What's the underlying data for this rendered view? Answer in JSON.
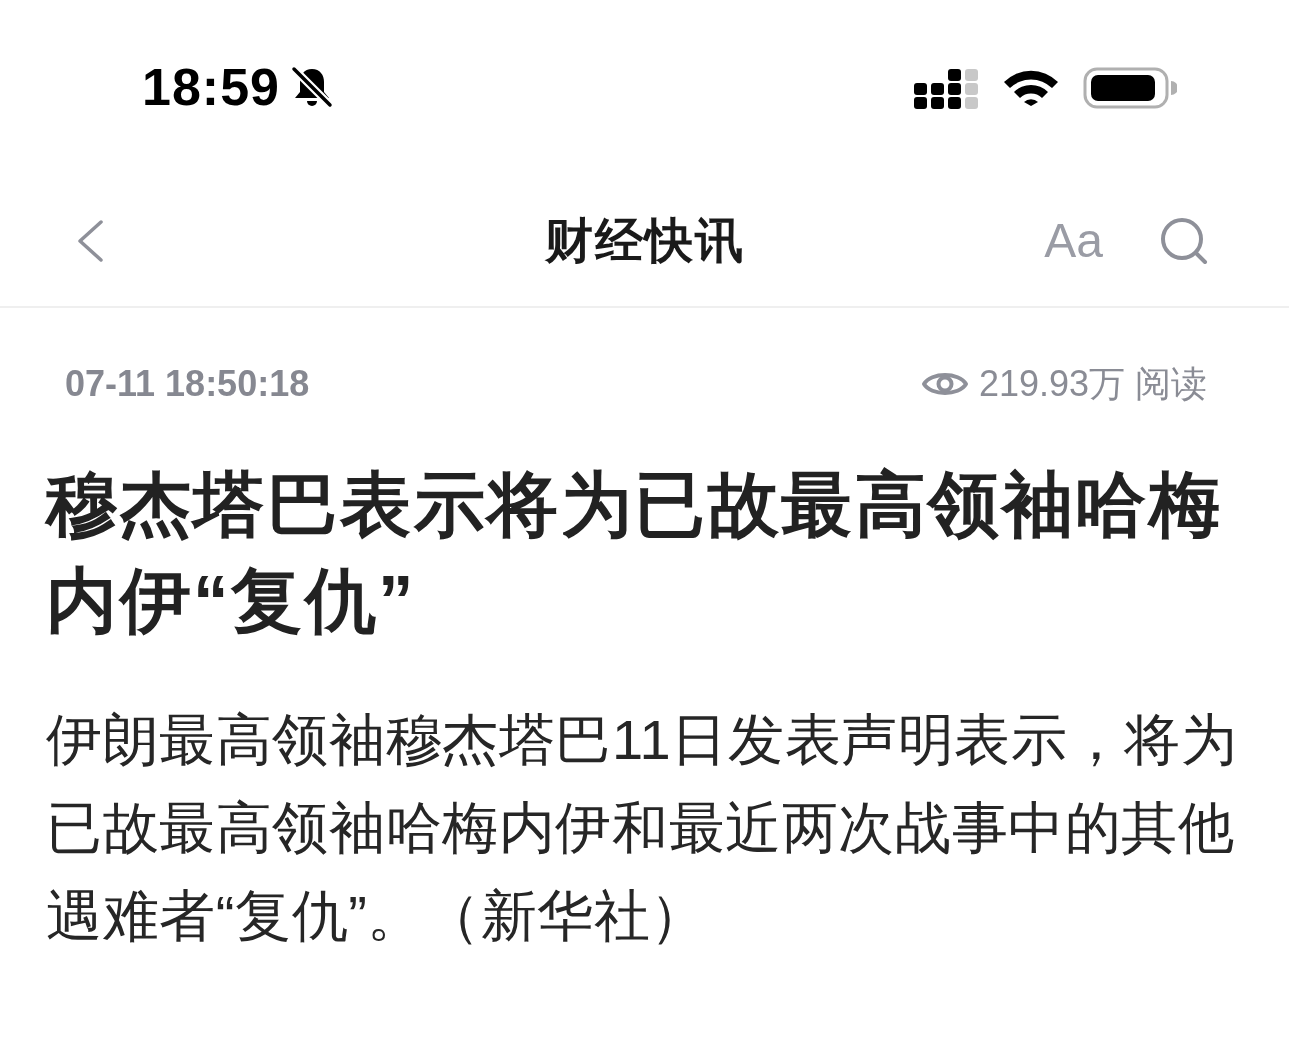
{
  "status_bar": {
    "time": "18:59"
  },
  "nav_bar": {
    "title": "财经快讯",
    "font_button": "Aa"
  },
  "article": {
    "timestamp": "07-11 18:50:18",
    "views": "219.93万 阅读",
    "headline": "穆杰塔巴表示将为已故最高领袖哈梅内伊“复仇”",
    "body": "伊朗最高领袖穆杰塔巴11日发表声明表示，将为已故最高领袖哈梅内伊和最近两次战事中的其他遇难者“复仇”。（新华社）"
  }
}
